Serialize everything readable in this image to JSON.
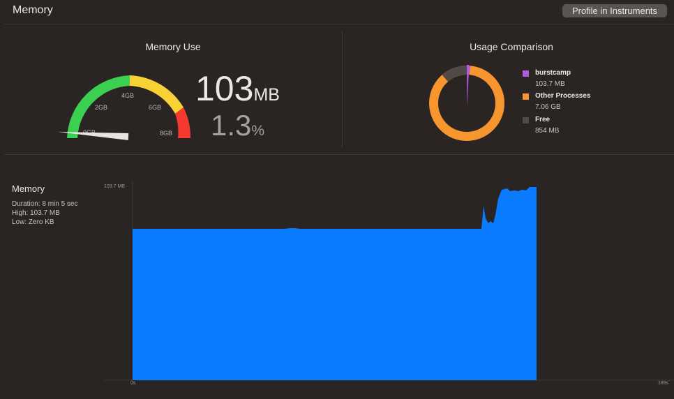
{
  "header": {
    "title": "Memory",
    "profile_button": "Profile in Instruments"
  },
  "memory_use": {
    "title": "Memory Use",
    "gauge_labels": [
      "0GB",
      "2GB",
      "4GB",
      "6GB",
      "8GB"
    ],
    "gauge_level": 0.0127,
    "value": "103",
    "value_unit": "MB",
    "percent": "1.3",
    "percent_unit": "%"
  },
  "usage_comparison": {
    "title": "Usage Comparison",
    "legend": [
      {
        "name": "burstcamp",
        "value": "103.7 MB",
        "color": "#b35be0"
      },
      {
        "name": "Other Processes",
        "value": "7.06 GB",
        "color": "#f7952e"
      },
      {
        "name": "Free",
        "value": "854 MB",
        "color": "#4f4a48"
      }
    ]
  },
  "memory_graph": {
    "title": "Memory",
    "duration": "Duration: 8 min 5 sec",
    "high": "High: 103.7 MB",
    "low": "Low: Zero KB",
    "y_max_label": "103.7 MB",
    "x_start_label": "0s",
    "x_end_label": "189s",
    "fill_color": "#0a7aff"
  }
}
